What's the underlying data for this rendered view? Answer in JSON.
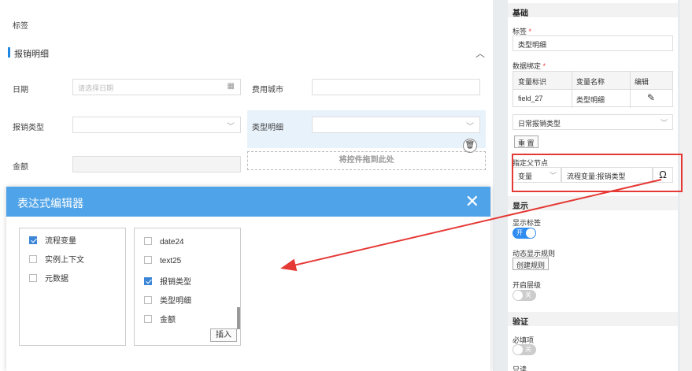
{
  "form": {
    "tag_label": "标签",
    "section_title": "报销明细",
    "collapse_icon": "chevron-up-icon",
    "date_label": "日期",
    "date_placeholder": "请选择日期",
    "city_label": "费用城市",
    "type_label": "报销类型",
    "detail_label": "类型明细",
    "amount_label": "金额",
    "dropzone_text": "将控件拖到此处",
    "delete_icon": "trash-icon"
  },
  "modal": {
    "title": "表达式编辑器",
    "close_icon": "close-icon",
    "left_items": [
      {
        "label": "流程变量",
        "checked": true
      },
      {
        "label": "实例上下文",
        "checked": false
      },
      {
        "label": "元数据",
        "checked": false
      }
    ],
    "right_items": [
      {
        "label": "date24",
        "checked": false
      },
      {
        "label": "text25",
        "checked": false
      },
      {
        "label": "报销类型",
        "checked": true
      },
      {
        "label": "类型明细",
        "checked": false
      },
      {
        "label": "金额",
        "checked": false
      }
    ],
    "insert_label": "插入"
  },
  "props": {
    "basic_header": "基础",
    "tag_label": "标签",
    "required_mark": "*",
    "tag_value": "类型明细",
    "binding_label": "数据绑定",
    "binding_cols": [
      "变量标识",
      "变量名称",
      "编辑"
    ],
    "binding_row": {
      "id": "field_27",
      "name": "类型明细"
    },
    "edit_icon": "pencil-icon",
    "binding_select": "日常报销类型",
    "reset_label": "重 置",
    "parent_label": "指定父节点",
    "parent_type": "变量",
    "parent_value": "流程变量:报销类型",
    "omega_symbol": "Ω",
    "display_header": "显示",
    "show_label_label": "显示标签",
    "toggle_on": "开",
    "toggle_off": "关",
    "dynamic_rule_label": "动态显示规则",
    "create_rule_label": "创建规则",
    "hierarchy_label": "开启层级",
    "validation_header": "验证",
    "required_label": "必填项",
    "readonly_label": "只读"
  },
  "colors": {
    "modal_header": "#4fa3e8",
    "accent": "#1e88e5",
    "annotation": "#e53935"
  }
}
